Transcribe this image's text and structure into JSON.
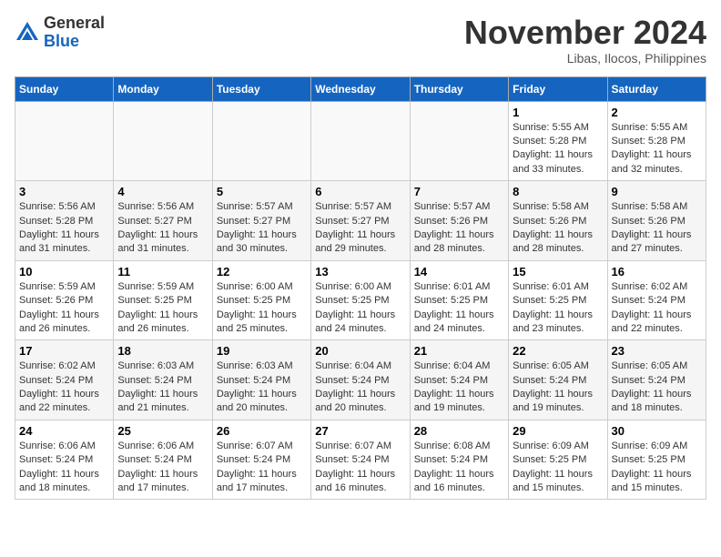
{
  "logo": {
    "general": "General",
    "blue": "Blue"
  },
  "header": {
    "month": "November 2024",
    "location": "Libas, Ilocos, Philippines"
  },
  "weekdays": [
    "Sunday",
    "Monday",
    "Tuesday",
    "Wednesday",
    "Thursday",
    "Friday",
    "Saturday"
  ],
  "weeks": [
    [
      {
        "day": "",
        "info": ""
      },
      {
        "day": "",
        "info": ""
      },
      {
        "day": "",
        "info": ""
      },
      {
        "day": "",
        "info": ""
      },
      {
        "day": "",
        "info": ""
      },
      {
        "day": "1",
        "info": "Sunrise: 5:55 AM\nSunset: 5:28 PM\nDaylight: 11 hours and 33 minutes."
      },
      {
        "day": "2",
        "info": "Sunrise: 5:55 AM\nSunset: 5:28 PM\nDaylight: 11 hours and 32 minutes."
      }
    ],
    [
      {
        "day": "3",
        "info": "Sunrise: 5:56 AM\nSunset: 5:28 PM\nDaylight: 11 hours and 31 minutes."
      },
      {
        "day": "4",
        "info": "Sunrise: 5:56 AM\nSunset: 5:27 PM\nDaylight: 11 hours and 31 minutes."
      },
      {
        "day": "5",
        "info": "Sunrise: 5:57 AM\nSunset: 5:27 PM\nDaylight: 11 hours and 30 minutes."
      },
      {
        "day": "6",
        "info": "Sunrise: 5:57 AM\nSunset: 5:27 PM\nDaylight: 11 hours and 29 minutes."
      },
      {
        "day": "7",
        "info": "Sunrise: 5:57 AM\nSunset: 5:26 PM\nDaylight: 11 hours and 28 minutes."
      },
      {
        "day": "8",
        "info": "Sunrise: 5:58 AM\nSunset: 5:26 PM\nDaylight: 11 hours and 28 minutes."
      },
      {
        "day": "9",
        "info": "Sunrise: 5:58 AM\nSunset: 5:26 PM\nDaylight: 11 hours and 27 minutes."
      }
    ],
    [
      {
        "day": "10",
        "info": "Sunrise: 5:59 AM\nSunset: 5:26 PM\nDaylight: 11 hours and 26 minutes."
      },
      {
        "day": "11",
        "info": "Sunrise: 5:59 AM\nSunset: 5:25 PM\nDaylight: 11 hours and 26 minutes."
      },
      {
        "day": "12",
        "info": "Sunrise: 6:00 AM\nSunset: 5:25 PM\nDaylight: 11 hours and 25 minutes."
      },
      {
        "day": "13",
        "info": "Sunrise: 6:00 AM\nSunset: 5:25 PM\nDaylight: 11 hours and 24 minutes."
      },
      {
        "day": "14",
        "info": "Sunrise: 6:01 AM\nSunset: 5:25 PM\nDaylight: 11 hours and 24 minutes."
      },
      {
        "day": "15",
        "info": "Sunrise: 6:01 AM\nSunset: 5:25 PM\nDaylight: 11 hours and 23 minutes."
      },
      {
        "day": "16",
        "info": "Sunrise: 6:02 AM\nSunset: 5:24 PM\nDaylight: 11 hours and 22 minutes."
      }
    ],
    [
      {
        "day": "17",
        "info": "Sunrise: 6:02 AM\nSunset: 5:24 PM\nDaylight: 11 hours and 22 minutes."
      },
      {
        "day": "18",
        "info": "Sunrise: 6:03 AM\nSunset: 5:24 PM\nDaylight: 11 hours and 21 minutes."
      },
      {
        "day": "19",
        "info": "Sunrise: 6:03 AM\nSunset: 5:24 PM\nDaylight: 11 hours and 20 minutes."
      },
      {
        "day": "20",
        "info": "Sunrise: 6:04 AM\nSunset: 5:24 PM\nDaylight: 11 hours and 20 minutes."
      },
      {
        "day": "21",
        "info": "Sunrise: 6:04 AM\nSunset: 5:24 PM\nDaylight: 11 hours and 19 minutes."
      },
      {
        "day": "22",
        "info": "Sunrise: 6:05 AM\nSunset: 5:24 PM\nDaylight: 11 hours and 19 minutes."
      },
      {
        "day": "23",
        "info": "Sunrise: 6:05 AM\nSunset: 5:24 PM\nDaylight: 11 hours and 18 minutes."
      }
    ],
    [
      {
        "day": "24",
        "info": "Sunrise: 6:06 AM\nSunset: 5:24 PM\nDaylight: 11 hours and 18 minutes."
      },
      {
        "day": "25",
        "info": "Sunrise: 6:06 AM\nSunset: 5:24 PM\nDaylight: 11 hours and 17 minutes."
      },
      {
        "day": "26",
        "info": "Sunrise: 6:07 AM\nSunset: 5:24 PM\nDaylight: 11 hours and 17 minutes."
      },
      {
        "day": "27",
        "info": "Sunrise: 6:07 AM\nSunset: 5:24 PM\nDaylight: 11 hours and 16 minutes."
      },
      {
        "day": "28",
        "info": "Sunrise: 6:08 AM\nSunset: 5:24 PM\nDaylight: 11 hours and 16 minutes."
      },
      {
        "day": "29",
        "info": "Sunrise: 6:09 AM\nSunset: 5:25 PM\nDaylight: 11 hours and 15 minutes."
      },
      {
        "day": "30",
        "info": "Sunrise: 6:09 AM\nSunset: 5:25 PM\nDaylight: 11 hours and 15 minutes."
      }
    ]
  ]
}
